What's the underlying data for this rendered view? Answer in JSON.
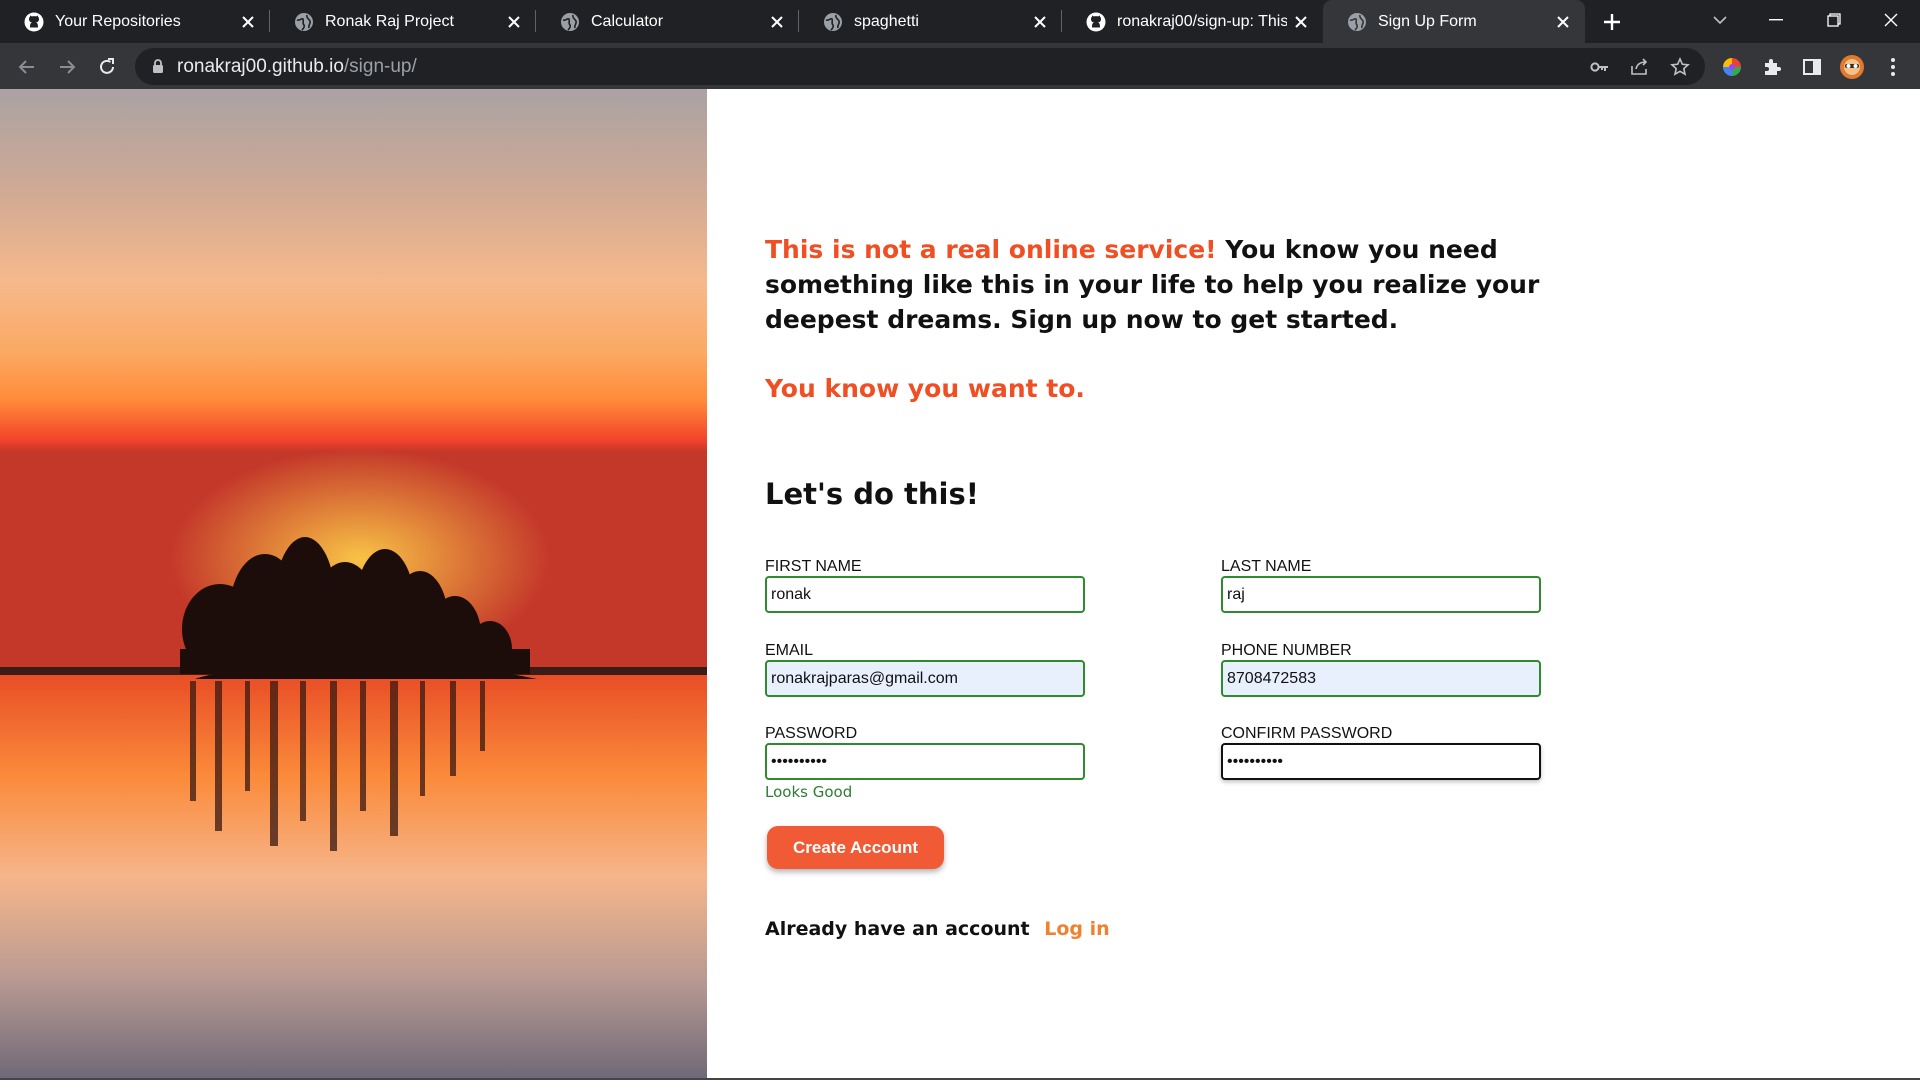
{
  "browser": {
    "tabs": [
      {
        "title": "Your Repositories",
        "icon": "github-icon",
        "active": false
      },
      {
        "title": "Ronak Raj Project",
        "icon": "globe-icon",
        "active": false
      },
      {
        "title": "Calculator",
        "icon": "globe-icon",
        "active": false
      },
      {
        "title": "spaghetti",
        "icon": "globe-icon",
        "active": false
      },
      {
        "title": "ronakraj00/sign-up: This is",
        "icon": "github-icon",
        "active": false
      },
      {
        "title": "Sign Up Form",
        "icon": "globe-icon",
        "active": true
      }
    ],
    "url_host": "ronakraj00.github.io",
    "url_path": "/sign-up/"
  },
  "page": {
    "intro_accent": "This is not a real online service!",
    "intro_rest": " You know you need something like this in your life to help you realize your deepest dreams. Sign up now to get started.",
    "tagline": "You know you want to.",
    "heading": "Let's do this!",
    "fields": {
      "first_name": {
        "label": "FIRST NAME",
        "value": "ronak"
      },
      "last_name": {
        "label": "LAST NAME",
        "value": "raj"
      },
      "email": {
        "label": "EMAIL",
        "value": "ronakrajparas@gmail.com"
      },
      "phone": {
        "label": "PHONE NUMBER",
        "value": "8708472583"
      },
      "password": {
        "label": "PASSWORD",
        "value": "••••••••••",
        "hint": "Looks Good"
      },
      "confirm_password": {
        "label": "CONFIRM PASSWORD",
        "value": "••••••••••"
      }
    },
    "create_button": "Create Account",
    "login_prompt": "Already have an account",
    "login_link": "Log in"
  },
  "colors": {
    "accent": "#f04e23",
    "valid_border": "#2e8b2e",
    "button": "#f05a35",
    "link": "#f0822f"
  }
}
